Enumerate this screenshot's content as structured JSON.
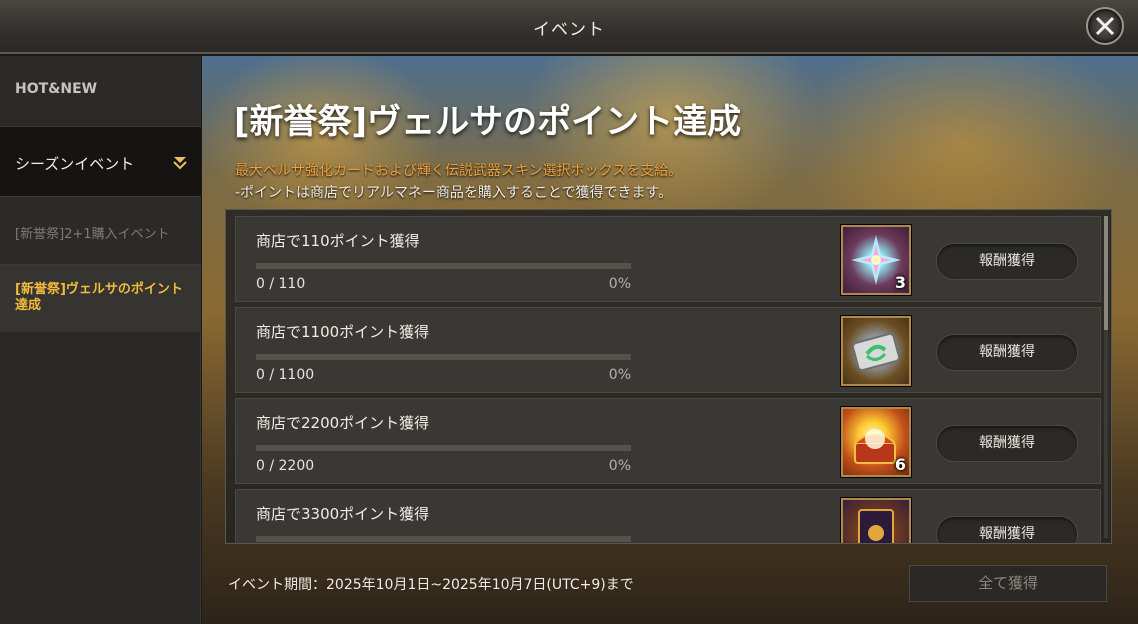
{
  "header": {
    "title": "イベント"
  },
  "sidebar": {
    "items": [
      {
        "label": "HOT&NEW"
      },
      {
        "label": "シーズンイベント"
      },
      {
        "label": "[新誉祭]2+1購入イベント"
      },
      {
        "label": "[新誉祭]ヴェルサのポイント達成"
      }
    ]
  },
  "event": {
    "title": "[新誉祭]ヴェルサのポイント達成",
    "desc1": "最大ベルサ強化カードおよび輝く伝説武器スキン選択ボックスを支給。",
    "desc2": "-ポイントは商店でリアルマネー商品を購入することで獲得できます。"
  },
  "missions": [
    {
      "title": "商店で110ポイント獲得",
      "count": "0 / 110",
      "pct": "0%",
      "progress": 0,
      "reward_icon": "crystal-bundle-icon",
      "qty": "3",
      "button": "報酬獲得"
    },
    {
      "title": "商店で1100ポイント獲得",
      "count": "0 / 1100",
      "pct": "0%",
      "progress": 0,
      "reward_icon": "enhance-card-icon",
      "qty": "",
      "button": "報酬獲得"
    },
    {
      "title": "商店で2200ポイント獲得",
      "count": "0 / 2200",
      "pct": "0%",
      "progress": 0,
      "reward_icon": "treasure-chest-icon",
      "qty": "6",
      "button": "報酬獲得"
    },
    {
      "title": "商店で3300ポイント獲得",
      "count": "",
      "pct": "",
      "progress": 0,
      "reward_icon": "skin-box-icon",
      "qty": "",
      "button": "報酬獲得"
    }
  ],
  "footer": {
    "period": "イベント期間：2025年10月1日~2025年10月7日(UTC+9)まで",
    "claim_all": "全て獲得"
  },
  "colors": {
    "accent_gold": "#f2bb3e",
    "desc_orange": "#eda23c"
  }
}
